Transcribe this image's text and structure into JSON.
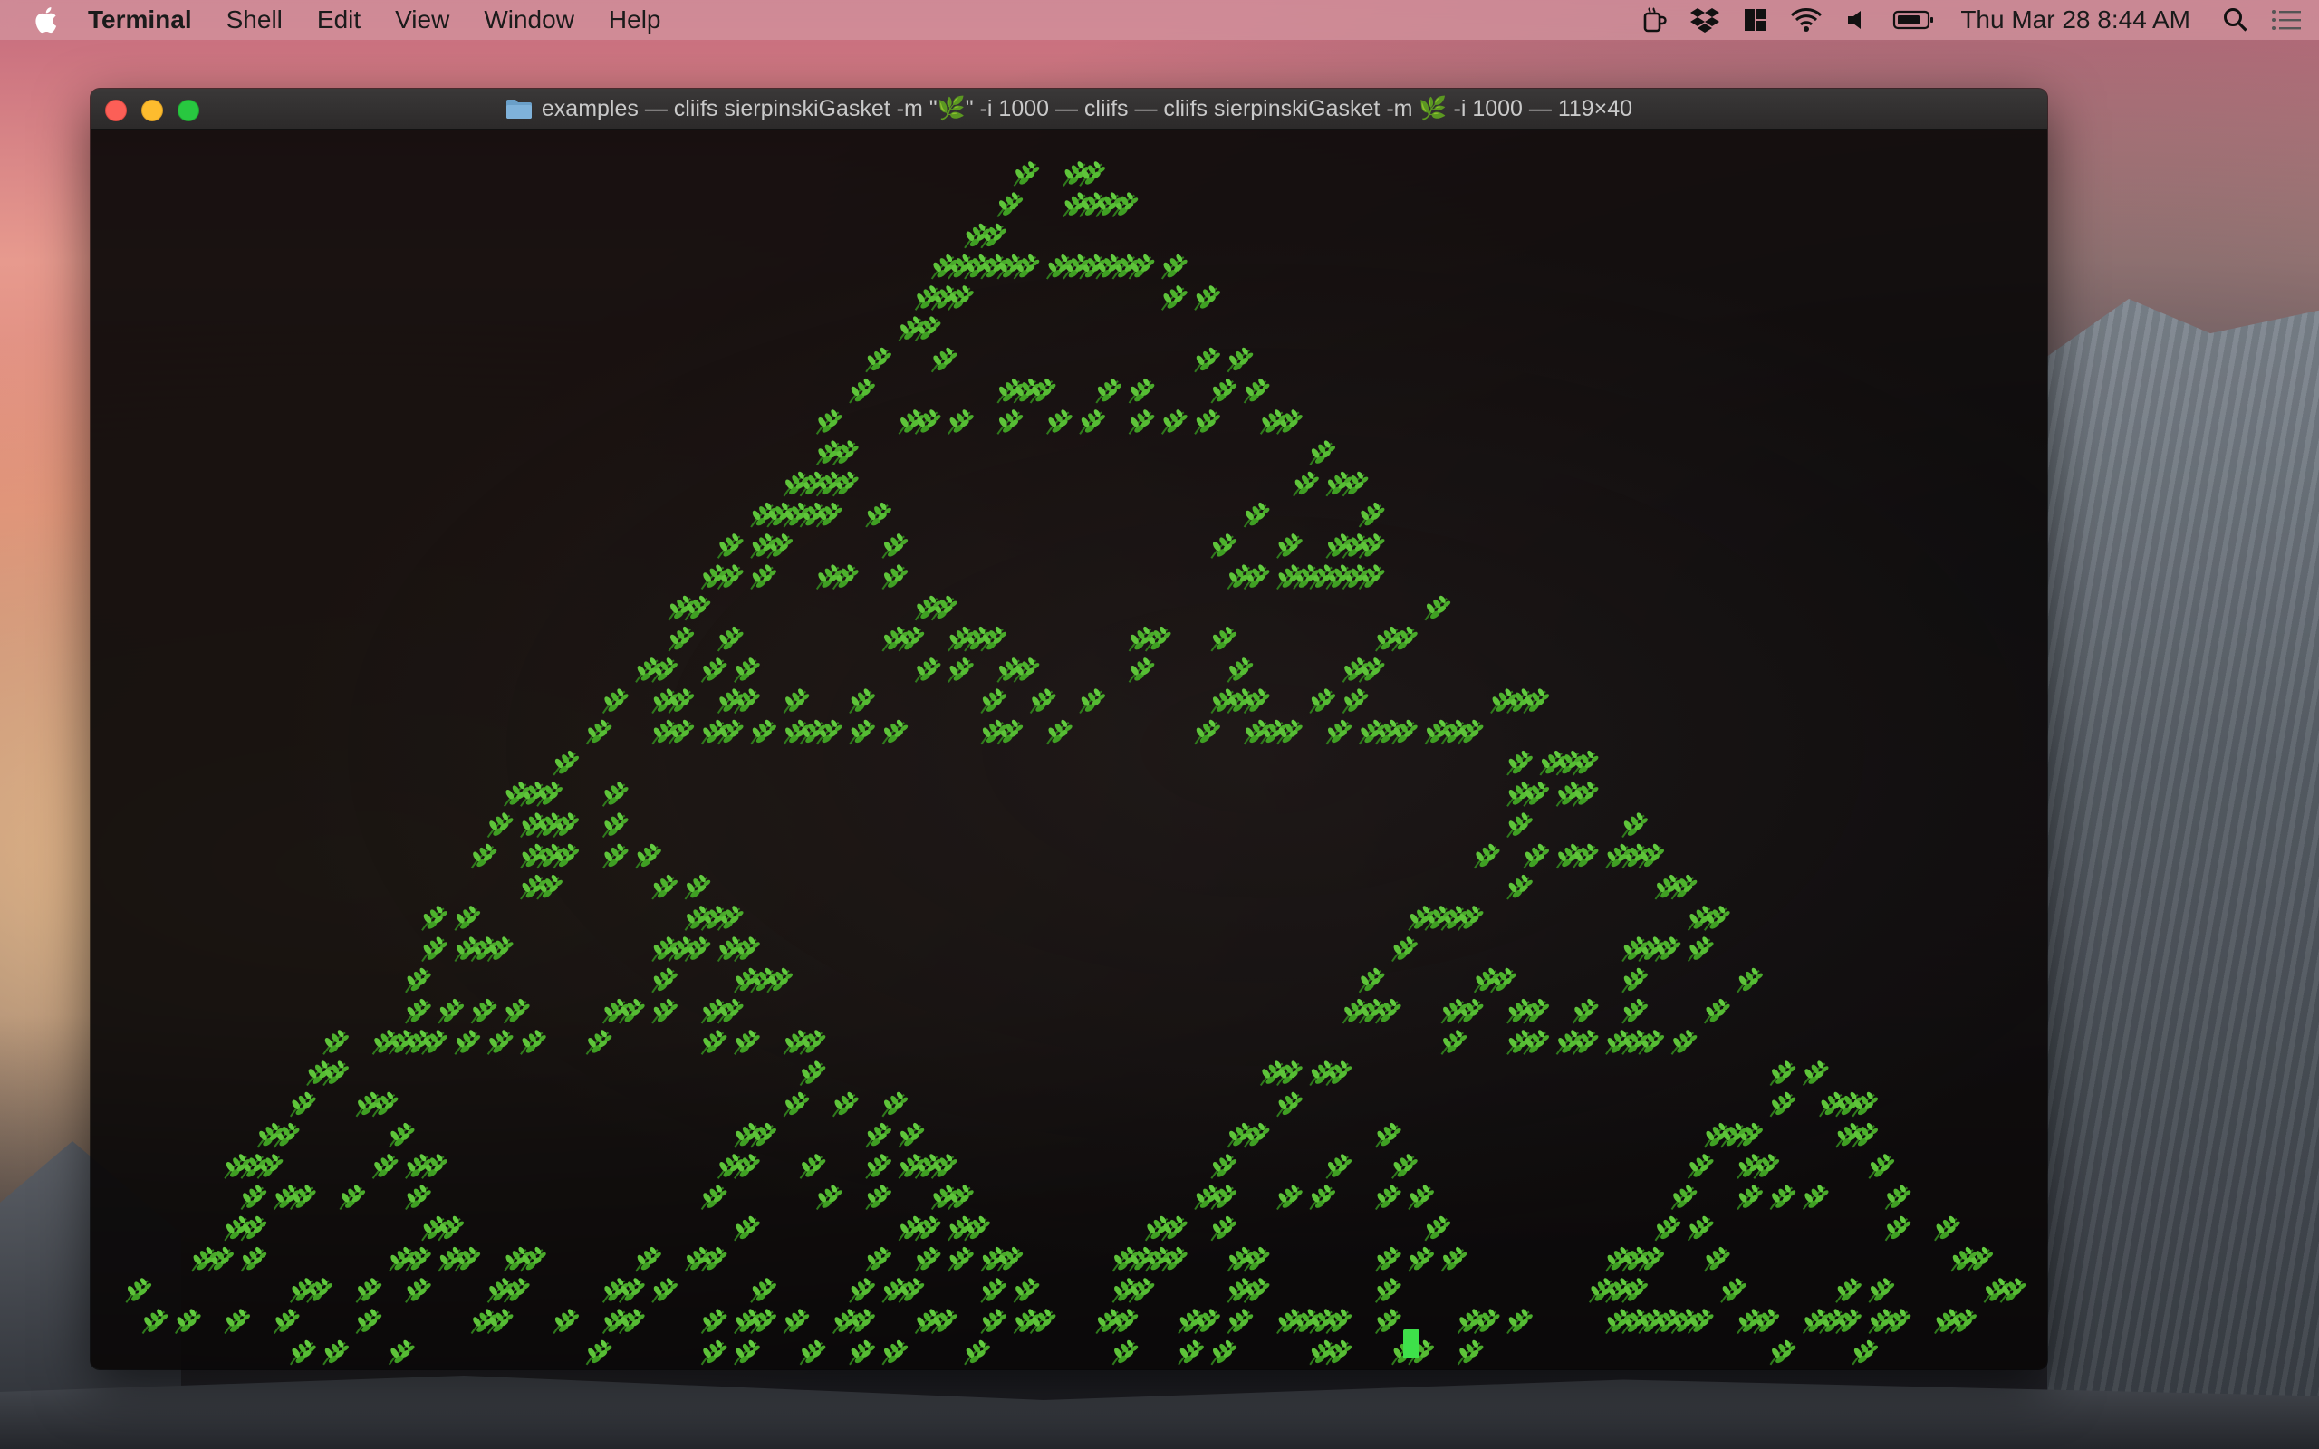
{
  "menubar": {
    "app_name": "Terminal",
    "menus": [
      "Shell",
      "Edit",
      "View",
      "Window",
      "Help"
    ],
    "clock": "Thu Mar 28  8:44 AM",
    "status_icons": [
      "hot-cup-icon",
      "dropbox-icon",
      "window-layout-icon",
      "wifi-icon",
      "volume-icon",
      "battery-icon",
      "search-icon",
      "notification-center-icon"
    ]
  },
  "window": {
    "title": "examples — cliifs sierpinskiGasket -m \"🌿\" -i 1000 — cliifs — cliifs sierpinskiGasket -m 🌿 -i 1000 — 119×40"
  },
  "terminal": {
    "marker_glyph": "🌿",
    "marker_color": "#3fae2a",
    "cursor_color": "#3ee04a",
    "prompt_mark": "*"
  }
}
